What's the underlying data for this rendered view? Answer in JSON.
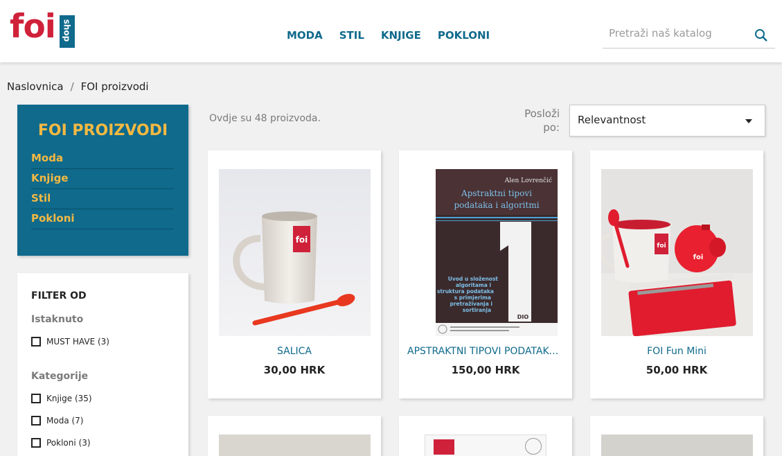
{
  "header": {
    "logo_text": "foi",
    "logo_shop": "shop",
    "nav": [
      "MODA",
      "STIL",
      "KNJIGE",
      "POKLONI"
    ],
    "search_placeholder": "Pretraži naš katalog"
  },
  "breadcrumb": {
    "home": "Naslovnica",
    "separator": "/",
    "current": "FOI proizvodi"
  },
  "sidebar": {
    "title": "FOI PROIZVODI",
    "categories": [
      "Moda",
      "Knjige",
      "Stil",
      "Pokloni"
    ],
    "filter_title": "FILTER OD",
    "group_featured": "Istaknuto",
    "featured_items": [
      "MUST HAVE (3)"
    ],
    "group_categories": "Kategorije",
    "category_filters": [
      "Knjige (35)",
      "Moda (7)",
      "Pokloni (3)"
    ]
  },
  "listing": {
    "count_text": "Ovdje su 48 proizvoda.",
    "sort_label": "Posloži po:",
    "sort_value": "Relevantnost"
  },
  "products": [
    {
      "name": "ŠALICA",
      "price": "30,00 HRK"
    },
    {
      "name": "APSTRAKTNI TIPOVI PODATAKA I ALGORITMI",
      "price": "150,00 HRK"
    },
    {
      "name": "FOI Fun Mini",
      "price": "50,00 HRK"
    }
  ],
  "book": {
    "author": "Alen Lovrenčić",
    "title_line1": "Apstraktni tipovi",
    "title_line2": "podataka i algoritmi",
    "number": "1",
    "subtitle": [
      "Uvod u složenost",
      "algoritama i",
      "struktura podataka",
      "s primjerima",
      "pretraživanja i",
      "sortiranja"
    ],
    "part": "DIO"
  },
  "colors": {
    "brand_blue": "#0f6a8c",
    "brand_red": "#d0213a",
    "accent_yellow": "#f4b942"
  }
}
